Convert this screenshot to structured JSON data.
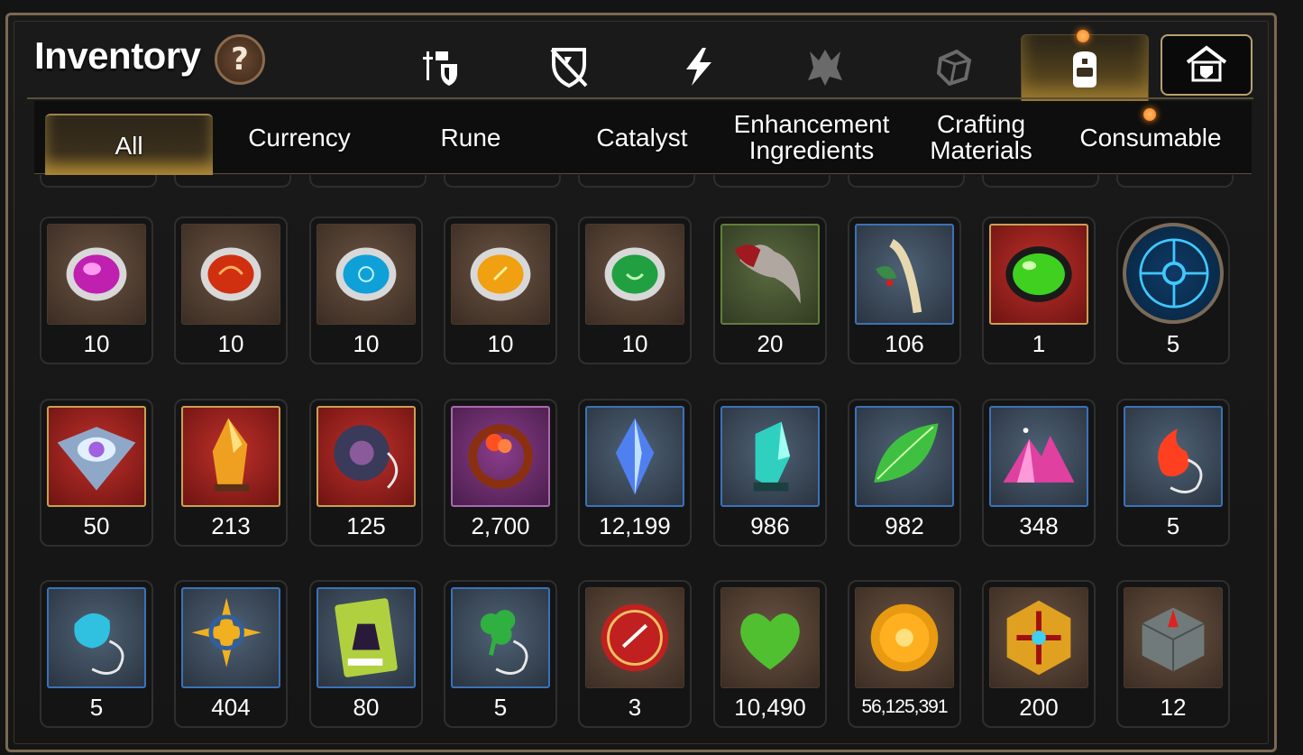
{
  "header": {
    "title": "Inventory",
    "help_label": "?"
  },
  "category_tabs": [
    {
      "icon": "knight-sword-shield-icon"
    },
    {
      "icon": "broken-shield-icon"
    },
    {
      "icon": "lightning-bolt-icon"
    },
    {
      "icon": "demon-icon"
    },
    {
      "icon": "crystal-box-icon"
    },
    {
      "icon": "backpack-icon",
      "active": true,
      "notification": true
    },
    {
      "icon": "guild-armor-icon"
    }
  ],
  "subtabs": [
    {
      "label": "All",
      "active": true
    },
    {
      "label": "Currency"
    },
    {
      "label": "Rune"
    },
    {
      "label": "Catalyst"
    },
    {
      "label": "Enhancement Ingredients"
    },
    {
      "label": "Crafting Materials"
    },
    {
      "label": "Consumable",
      "notification": true
    }
  ],
  "items": [
    {
      "icon": "pink-rune-stone-icon",
      "qty": "10",
      "frame": "brown"
    },
    {
      "icon": "red-rune-stone-icon",
      "qty": "10",
      "frame": "brown"
    },
    {
      "icon": "blue-rune-stone-icon",
      "qty": "10",
      "frame": "brown"
    },
    {
      "icon": "yellow-rune-stone-icon",
      "qty": "10",
      "frame": "brown"
    },
    {
      "icon": "green-rune-stone-icon",
      "qty": "10",
      "frame": "brown"
    },
    {
      "icon": "beast-claw-icon",
      "qty": "20",
      "frame": "green"
    },
    {
      "icon": "herb-root-icon",
      "qty": "106",
      "frame": "blue"
    },
    {
      "icon": "green-gem-icon",
      "qty": "1",
      "frame": "red"
    },
    {
      "icon": "blue-rune-circle-icon",
      "qty": "5",
      "frame": "round"
    },
    {
      "icon": "crystal-eye-icon",
      "qty": "50",
      "frame": "red"
    },
    {
      "icon": "amber-crystal-icon",
      "qty": "213",
      "frame": "red"
    },
    {
      "icon": "dark-ring-amulet-icon",
      "qty": "125",
      "frame": "red"
    },
    {
      "icon": "flower-ring-icon",
      "qty": "2,700",
      "frame": "purple"
    },
    {
      "icon": "blue-crystal-icon",
      "qty": "12,199",
      "frame": "blue"
    },
    {
      "icon": "teal-crystal-icon",
      "qty": "986",
      "frame": "blue"
    },
    {
      "icon": "green-leaf-icon",
      "qty": "982",
      "frame": "blue"
    },
    {
      "icon": "pink-crystal-pile-icon",
      "qty": "348",
      "frame": "blue"
    },
    {
      "icon": "fire-pendant-icon",
      "qty": "5",
      "frame": "blue"
    },
    {
      "icon": "water-drop-pendant-icon",
      "qty": "5",
      "frame": "blue"
    },
    {
      "icon": "star-pendant-icon",
      "qty": "404",
      "frame": "blue"
    },
    {
      "icon": "costume-ticket-icon",
      "qty": "80",
      "frame": "blue"
    },
    {
      "icon": "clover-pendant-icon",
      "qty": "5",
      "frame": "blue"
    },
    {
      "icon": "red-seal-badge-icon",
      "qty": "3",
      "frame": "brown"
    },
    {
      "icon": "green-heart-icon",
      "qty": "10,490",
      "frame": "brown"
    },
    {
      "icon": "gold-sun-coin-icon",
      "qty": "56,125,391",
      "frame": "brown",
      "small": true
    },
    {
      "icon": "golden-hexagon-emblem-icon",
      "qty": "200",
      "frame": "brown"
    },
    {
      "icon": "stone-compass-cube-icon",
      "qty": "12",
      "frame": "brown"
    }
  ],
  "colors": {
    "frame_border": "#7a6a52",
    "active_tab_glow": "#6e5621",
    "notification": "#ff7a10"
  }
}
